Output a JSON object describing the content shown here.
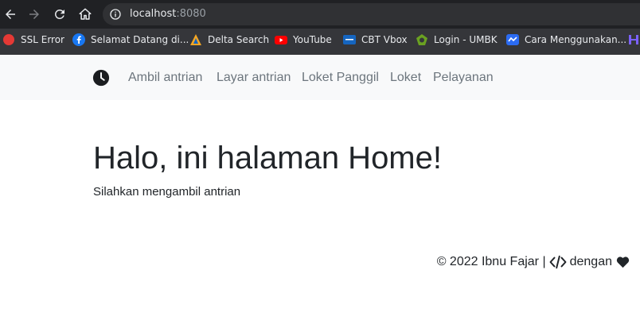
{
  "browser": {
    "url_host": "localhost",
    "url_port": ":8080",
    "bookmarks": [
      {
        "label": "SSL Error",
        "icon": "ssl-error-icon"
      },
      {
        "label": "Selamat Datang di...",
        "icon": "facebook-icon"
      },
      {
        "label": "Delta Search",
        "icon": "delta-search-icon"
      },
      {
        "label": "YouTube",
        "icon": "youtube-icon"
      },
      {
        "label": "CBT Vbox",
        "icon": "cbt-vbox-icon"
      },
      {
        "label": "Login - UMBK",
        "icon": "umbk-icon"
      },
      {
        "label": "Cara Menggunakan...",
        "icon": "chart-favicon-icon"
      }
    ]
  },
  "navbar": {
    "brand_icon": "clock-icon",
    "links": [
      "Ambil antrian",
      "Layar antrian",
      "Loket Panggil",
      "Loket",
      "Pelayanan"
    ]
  },
  "main": {
    "title": "Halo, ini halaman Home!",
    "subtitle": "Silahkan mengambil antrian"
  },
  "footer": {
    "credit": "© 2022 Ibnu Fajar |",
    "dengan": "dengan",
    "code_icon": "code-icon",
    "heart_icon": "heart-icon"
  },
  "colors": {
    "chrome_dark": "#202124",
    "bookmark_bar": "#35363a",
    "navbar_bg": "#f8f9fa",
    "nav_link": "#6c757d",
    "text": "#212529"
  }
}
